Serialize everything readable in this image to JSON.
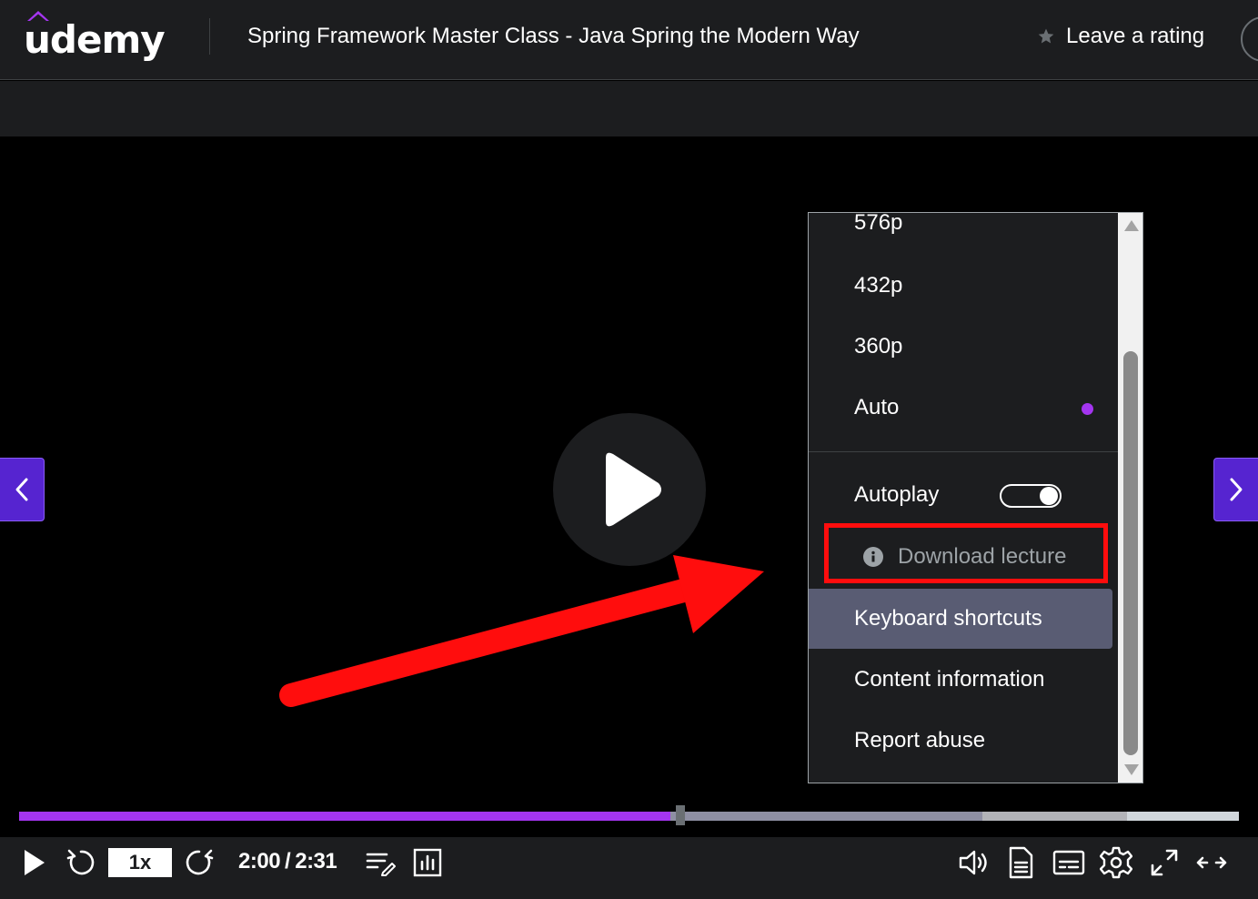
{
  "header": {
    "logo_text": "udemy",
    "course_title": "Spring Framework Master Class - Java Spring the Modern Way",
    "rating_label": "Leave a rating"
  },
  "settings_menu": {
    "quality_options": [
      {
        "label": "576p",
        "selected": false
      },
      {
        "label": "432p",
        "selected": false
      },
      {
        "label": "360p",
        "selected": false
      },
      {
        "label": "Auto",
        "selected": true
      }
    ],
    "autoplay_label": "Autoplay",
    "autoplay_on": true,
    "download_label": "Download lecture",
    "keyboard_label": "Keyboard shortcuts",
    "content_info_label": "Content information",
    "report_label": "Report abuse"
  },
  "player": {
    "speed": "1x",
    "current_time": "2:00",
    "time_separator": "/",
    "duration": "2:31",
    "played_fraction": 0.534,
    "buffered_fraction": 0.79,
    "buffered2_fraction": 0.908
  },
  "colors": {
    "brand_purple": "#a435f0",
    "nav_purple": "#5624d0",
    "header_bg": "#1c1d1f",
    "annotation_red": "#ff0d0d"
  },
  "icons": {
    "play": "play-icon",
    "rewind": "rewind-icon",
    "forward": "forward-icon",
    "notes": "notes-icon",
    "stats": "stats-icon",
    "volume": "volume-icon",
    "transcript": "transcript-icon",
    "captions": "captions-icon",
    "settings": "gear-icon",
    "fullscreen": "fullscreen-icon",
    "expand": "expand-icon"
  }
}
